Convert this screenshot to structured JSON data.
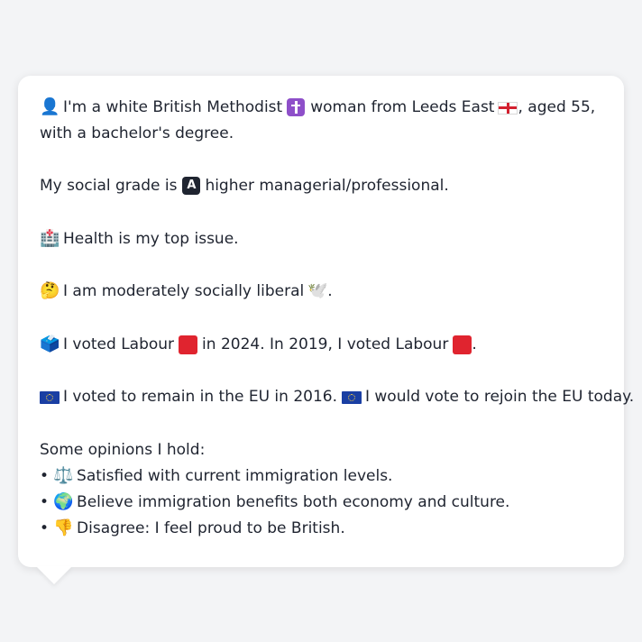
{
  "profile": {
    "line1": "I'm a white British Methodist",
    "line1b": "woman from Leeds East",
    "line1c": ", aged 55,",
    "line2": "with a bachelor's degree.",
    "grade_pre": "My social grade is",
    "grade_post": "higher managerial/professional.",
    "issue": "Health is my top issue.",
    "social": "I am moderately socially liberal",
    "social_end": ".",
    "vote_a": "I voted Labour",
    "vote_b": "in 2024. In 2019, I voted Labour",
    "vote_end": ".",
    "eu_a": "I voted to remain in the EU in 2016.",
    "eu_b": "I would vote to rejoin the EU today.",
    "opinions_heading": "Some opinions I hold:",
    "opinions": [
      "Satisfied with current immigration levels.",
      "Believe immigration benefits both economy and culture.",
      "Disagree: I feel proud to be British."
    ],
    "bullet": "•"
  },
  "icons": {
    "person": "👤",
    "hospital": "🏥",
    "thinking": "🤔",
    "dove": "🕊️",
    "ballot": "🗳️",
    "scales": "⚖️",
    "globe": "🌍",
    "thumbs_down": "👎",
    "grade_letter": "A"
  },
  "colors": {
    "labour_red": "#e0242f",
    "methodist_purple": "#8e4fc9",
    "eu_blue": "#1a3fa3",
    "text": "#1f2430"
  }
}
